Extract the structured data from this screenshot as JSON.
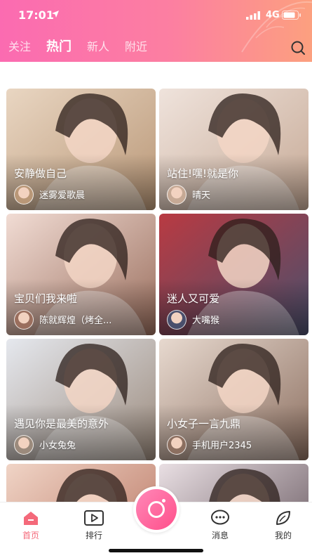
{
  "status_bar": {
    "time": "17:01",
    "network": "4G"
  },
  "tabs": [
    {
      "label": "关注",
      "active": false
    },
    {
      "label": "热门",
      "active": true
    },
    {
      "label": "新人",
      "active": false
    },
    {
      "label": "附近",
      "active": false
    }
  ],
  "cards": [
    {
      "title": "安静做自己",
      "user": "迷雾爱歌晨",
      "tone": [
        "#e9d6c2",
        "#b99777"
      ]
    },
    {
      "title": "站住!嘿!就是你",
      "user": "晴天",
      "tone": [
        "#efe3dc",
        "#c6a995"
      ]
    },
    {
      "title": "宝贝们我来啦",
      "user": "陈就辉煌（烤全...",
      "tone": [
        "#f1dcd4",
        "#9a6e5d"
      ]
    },
    {
      "title": "迷人又可爱",
      "user": "大嘴猴",
      "tone": [
        "#b93a42",
        "#4a4f6c"
      ]
    },
    {
      "title": "遇见你是最美的意外",
      "user": "小女兔兔",
      "tone": [
        "#e5e8ee",
        "#9b8a7c"
      ]
    },
    {
      "title": "小女子一言九鼎",
      "user": "手机用户2345",
      "tone": [
        "#e7d9cf",
        "#8c6f60"
      ]
    },
    {
      "title": "",
      "user": "",
      "tone": [
        "#f0d4c6",
        "#b46e5a"
      ]
    },
    {
      "title": "",
      "user": "",
      "tone": [
        "#e9dfe3",
        "#5a4a52"
      ]
    }
  ],
  "tabbar": {
    "items": [
      {
        "label": "首页",
        "icon": "home-icon",
        "active": true
      },
      {
        "label": "排行",
        "icon": "play-icon",
        "active": false
      },
      {
        "label": "消息",
        "icon": "message-icon",
        "active": false
      },
      {
        "label": "我的",
        "icon": "profile-leaf-icon",
        "active": false
      }
    ],
    "record_icon": "camera-record-icon"
  },
  "colors": {
    "accent": "#f4697a",
    "header_start": "#fb6bb1",
    "header_end": "#fca07f"
  }
}
